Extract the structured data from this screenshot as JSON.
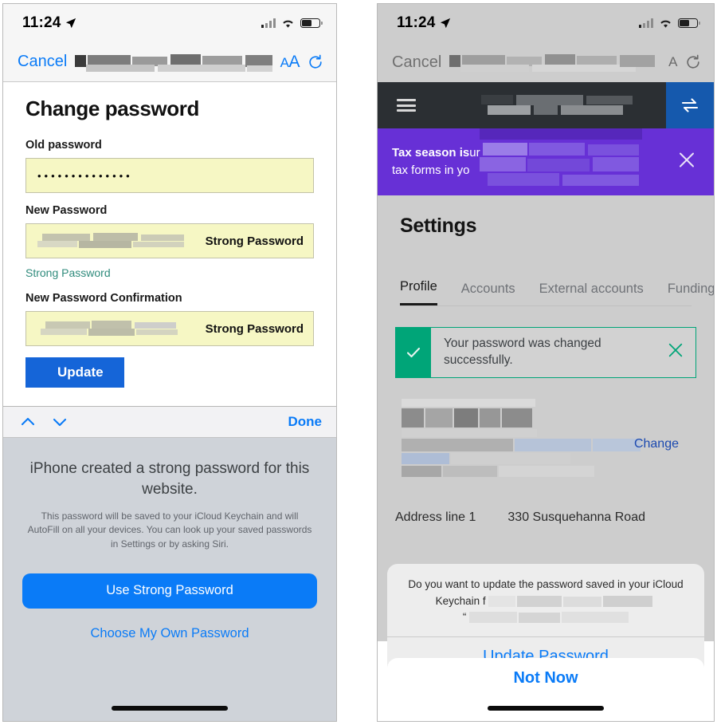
{
  "left_phone": {
    "status_bar": {
      "time": "11:24",
      "location_icon": "location-arrow-icon",
      "signal_icon": "cellular-bars-icon",
      "wifi_icon": "wifi-icon",
      "battery_icon": "battery-icon"
    },
    "safari_toolbar": {
      "cancel_label": "Cancel",
      "url_redacted": true,
      "text_size_label": "AA",
      "reload_icon": "reload-icon"
    },
    "page": {
      "title": "Change password",
      "old_password_label": "Old password",
      "old_password_value": "••••••••••••••",
      "new_password_label": "New Password",
      "new_password_tag": "Strong Password",
      "new_password_hint": "Strong Password",
      "confirm_label": "New Password Confirmation",
      "confirm_tag": "Strong Password",
      "update_button": "Update"
    },
    "autofill_sheet": {
      "prev_icon": "chevron-up-icon",
      "next_icon": "chevron-down-icon",
      "done_label": "Done",
      "headline": "iPhone created a strong password for this website.",
      "description": "This password will be saved to your iCloud Keychain and will AutoFill on all your devices. You can look up your saved passwords in Settings or by asking Siri.",
      "primary_button": "Use Strong Password",
      "secondary_button": "Choose My Own Password"
    }
  },
  "right_phone": {
    "status_bar": {
      "time": "11:24",
      "location_icon": "location-arrow-icon",
      "signal_icon": "cellular-bars-icon",
      "wifi_icon": "wifi-icon",
      "battery_icon": "battery-icon"
    },
    "safari_toolbar": {
      "cancel_label": "Cancel",
      "url_redacted": true,
      "text_size_label": "A",
      "reload_icon": "reload-icon"
    },
    "app": {
      "menu_icon": "hamburger-menu-icon",
      "transfer_icon": "transfer-arrows-icon",
      "promo_bold": "Tax season is",
      "promo_rest": "tax forms in yo",
      "promo_tail": "ur",
      "promo_close_icon": "close-icon",
      "settings_title": "Settings",
      "tabs": [
        {
          "label": "Profile",
          "active": true
        },
        {
          "label": "Accounts",
          "active": false
        },
        {
          "label": "External accounts",
          "active": false
        },
        {
          "label": "Funding",
          "active": false
        }
      ],
      "success_alert": {
        "check_icon": "check-icon",
        "message": "Your password was changed successfully.",
        "close_icon": "close-icon"
      },
      "change_link": "Change",
      "address_label": "Address line 1",
      "address_value": "330 Susquehanna Road"
    },
    "keychain_dialog": {
      "message_line1": "Do you want to update the password saved in your iCloud",
      "message_line2": "Keychain f",
      "message_quote": "“",
      "update_button": "Update Password",
      "not_now_button": "Not Now"
    }
  },
  "colors": {
    "ios_blue": "#0a7bf7",
    "autofill_yellow": "#f6f7c4",
    "strong_teal": "#2f8b7c",
    "success_green": "#00a578",
    "promo_purple": "#6730d6",
    "app_dark": "#2b2f33",
    "transfer_blue": "#1559ad",
    "update_blue": "#1565d8"
  }
}
